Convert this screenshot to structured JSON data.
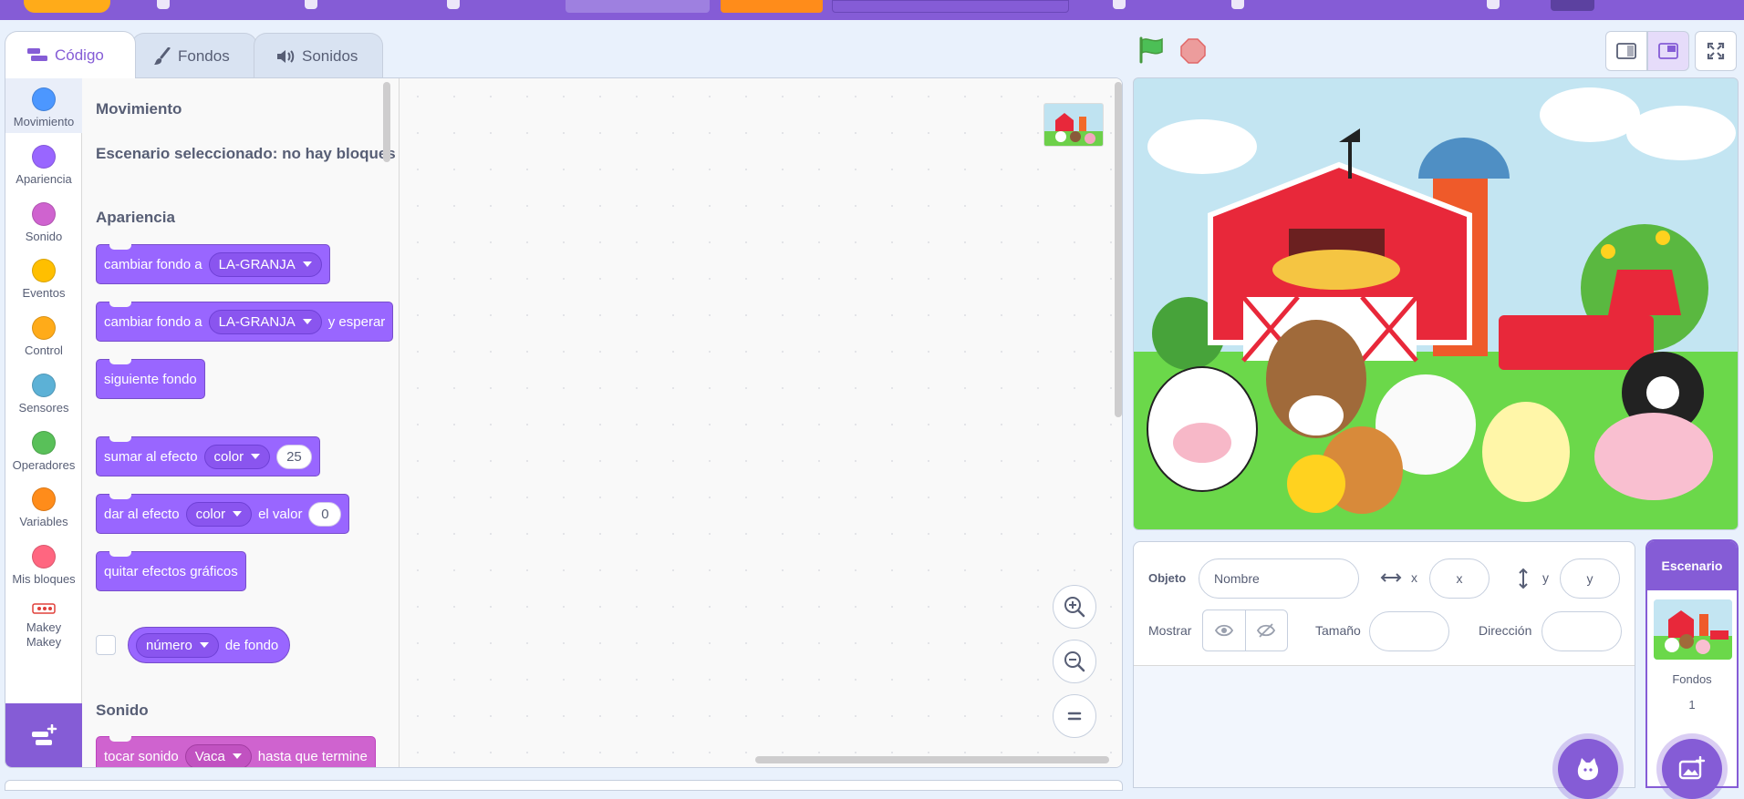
{
  "tabs": [
    {
      "label": "Código"
    },
    {
      "label": "Fondos"
    },
    {
      "label": "Sonidos"
    }
  ],
  "categories": [
    {
      "label": "Movimiento",
      "color": "#4c97ff"
    },
    {
      "label": "Apariencia",
      "color": "#9966ff"
    },
    {
      "label": "Sonido",
      "color": "#cf63cf"
    },
    {
      "label": "Eventos",
      "color": "#ffbf00"
    },
    {
      "label": "Control",
      "color": "#ffab19"
    },
    {
      "label": "Sensores",
      "color": "#5cb1d6"
    },
    {
      "label": "Operadores",
      "color": "#59c059"
    },
    {
      "label": "Variables",
      "color": "#ff8c1a"
    },
    {
      "label": "Mis bloques",
      "color": "#ff6680"
    },
    {
      "label": "Makey Makey",
      "icon": "makey-makey-icon"
    }
  ],
  "flyout": {
    "heading_motion": "Movimiento",
    "stage_note": "Escenario seleccionado: no hay bloques",
    "heading_looks": "Apariencia",
    "heading_sound": "Sonido",
    "blocks": {
      "switch_backdrop": {
        "text": "cambiar fondo a",
        "menu": "LA-GRANJA"
      },
      "switch_backdrop_wait": {
        "text": "cambiar fondo a",
        "menu": "LA-GRANJA",
        "suffix": "y esperar"
      },
      "next_backdrop": {
        "text": "siguiente fondo"
      },
      "change_effect": {
        "text": "sumar al efecto",
        "menu": "color",
        "value": "25"
      },
      "set_effect": {
        "text": "dar al efecto",
        "menu": "color",
        "mid": "el valor",
        "value": "0"
      },
      "clear_effects": {
        "text": "quitar efectos gráficos"
      },
      "backdrop_number": {
        "menu": "número",
        "suffix": "de fondo"
      },
      "play_sound": {
        "text": "tocar sonido",
        "menu": "Vaca",
        "suffix": "hasta que termine"
      }
    }
  },
  "sprite_info": {
    "sprite_label": "Objeto",
    "name_placeholder": "Nombre",
    "x_label": "x",
    "x_placeholder": "x",
    "y_label": "y",
    "y_placeholder": "y",
    "show_label": "Mostrar",
    "size_label": "Tamaño",
    "direction_label": "Dirección"
  },
  "stage_selector": {
    "title": "Escenario",
    "backdrops_label": "Fondos",
    "backdrops_count": "1"
  },
  "colors": {
    "accent": "#855cd6",
    "looks": "#9966ff",
    "sound": "#cf63cf",
    "menubar": "#855cd6"
  }
}
